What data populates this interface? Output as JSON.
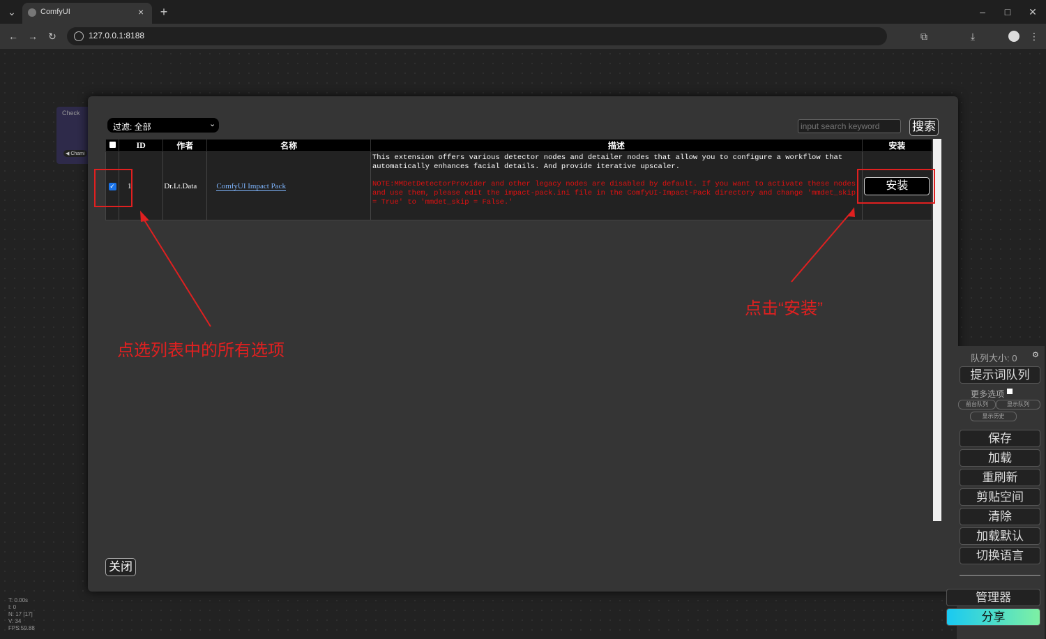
{
  "browser": {
    "tab_title": "ComfyUI",
    "url": "127.0.0.1:8188",
    "new_tab_symbol": "+",
    "close_tab_symbol": "×",
    "window_controls": {
      "minimize": "–",
      "maximize": "□",
      "close": "✕"
    }
  },
  "background_node": {
    "title": "Check",
    "pill": "◀ Chami"
  },
  "manager": {
    "filter_value": "过滤: 全部",
    "search_placeholder": "input search keyword",
    "search_button": "搜索",
    "columns": [
      "ID",
      "作者",
      "名称",
      "描述",
      "安装"
    ],
    "row": {
      "checked": true,
      "id": "1",
      "author": "Dr.Lt.Data",
      "name": "ComfyUI Impact Pack",
      "description": "This extension offers various detector nodes and detailer nodes that allow you to configure a workflow that automatically enhances facial details. And provide iterative upscaler.",
      "note": "NOTE:MMDetDetectorProvider and other legacy nodes are disabled by default. If you want to activate these nodes and use them, please edit the impact-pack.ini file in the ComfyUI-Impact-Pack directory and change 'mmdet_skip = True' to 'mmdet_skip = False.'",
      "install_button": "安装"
    },
    "close_button": "关闭"
  },
  "annotations": {
    "select_all_note": "点选列表中的所有选项",
    "click_install_note": "点击“安装”",
    "color": "#e02020"
  },
  "side_panel": {
    "queue_size": "队列大小: 0",
    "queue_prompt": "提示词队列",
    "more_options": "更多选项",
    "front_queue": "前台队列",
    "view_queue": "显示队列",
    "view_history": "显示历史",
    "buttons": [
      "保存",
      "加载",
      "重刷新",
      "剪贴空间",
      "清除",
      "加载默认",
      "切换语言"
    ],
    "manager": "管理器",
    "share": "分享"
  },
  "stats": [
    "T: 0.00s",
    "I: 0",
    "N: 17 [17]",
    "V: 34",
    "FPS:59.88"
  ]
}
